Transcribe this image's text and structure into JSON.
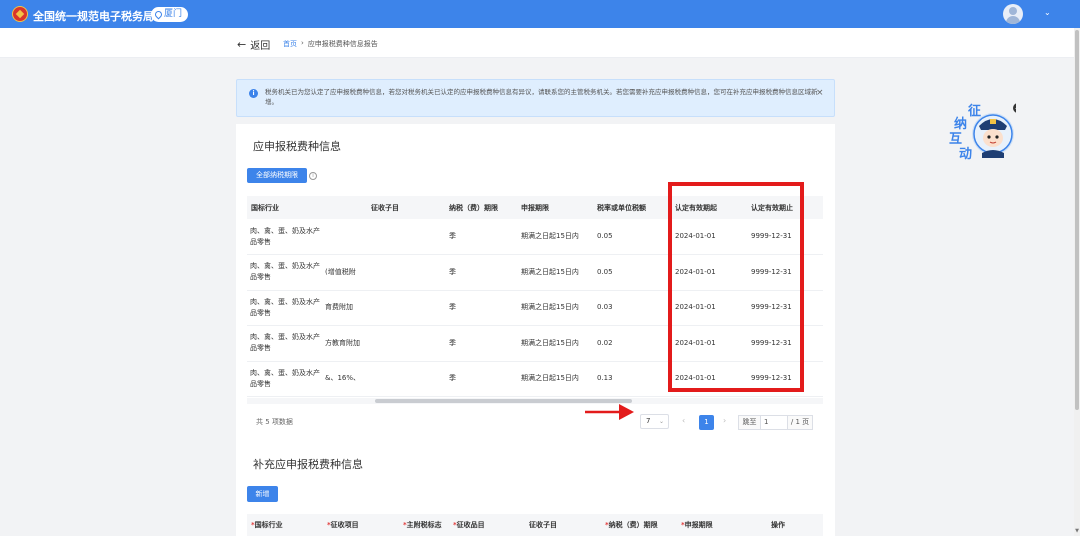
{
  "header": {
    "app_title": "全国统一规范电子税务局",
    "city": "厦门",
    "avatar_icon": "user-avatar-icon",
    "menu_icon": "chevron-down-icon"
  },
  "nav": {
    "back_label": "返回",
    "breadcrumb_home": "首页",
    "breadcrumb_sep": "›",
    "breadcrumb_current": "应申报税费种信息报告"
  },
  "alert": {
    "icon": "i",
    "text": "税务机关已为您认定了应申报税费种信息，若您对税务机关已认定的应申报税费种信息有异议，请联系您的主管税务机关。若您需要补充应申报税费种信息，您可在补充应申报税费种信息区域新增。",
    "close": "×"
  },
  "section1": {
    "title": "应申报税费种信息",
    "button": "全部纳税期限"
  },
  "table1": {
    "headers": [
      "国标行业",
      "征收子目",
      "纳税（费）期限",
      "申报期限",
      "税率或单位税额",
      "认定有效期起",
      "认定有效期止"
    ],
    "rows": [
      {
        "industry": "肉、禽、蛋、奶及水产品零售",
        "sub": "",
        "period": "季",
        "deadline": "期满之日起15日内",
        "rate": "0.05",
        "start": "2024-01-01",
        "end": "9999-12-31"
      },
      {
        "industry": "肉、禽、蛋、奶及水产品零售",
        "sub": "(增值税附",
        "period": "季",
        "deadline": "期满之日起15日内",
        "rate": "0.05",
        "start": "2024-01-01",
        "end": "9999-12-31"
      },
      {
        "industry": "肉、禽、蛋、奶及水产品零售",
        "sub": "育费附加",
        "period": "季",
        "deadline": "期满之日起15日内",
        "rate": "0.03",
        "start": "2024-01-01",
        "end": "9999-12-31"
      },
      {
        "industry": "肉、禽、蛋、奶及水产品零售",
        "sub": "方教育附加",
        "period": "季",
        "deadline": "期满之日起15日内",
        "rate": "0.02",
        "start": "2024-01-01",
        "end": "9999-12-31"
      },
      {
        "industry": "肉、禽、蛋、奶及水产品零售",
        "sub": "&、16%、",
        "period": "季",
        "deadline": "期满之日起15日内",
        "rate": "0.13",
        "start": "2024-01-01",
        "end": "9999-12-31"
      }
    ]
  },
  "pagination": {
    "total": "共 5 项数据",
    "page_size": "7",
    "prev": "‹",
    "current": "1",
    "next": "›",
    "jump_label": "跳至",
    "jump_value": "1",
    "page_total": "/ 1 页"
  },
  "section2": {
    "title": "补充应申报税费种信息",
    "button": "新增"
  },
  "table2": {
    "headers": [
      {
        "req": "*",
        "label": "国标行业"
      },
      {
        "req": "*",
        "label": "征收项目"
      },
      {
        "req": "*",
        "label": "主附税标志"
      },
      {
        "req": "*",
        "label": "征收品目"
      },
      {
        "req": "",
        "label": "征收子目"
      },
      {
        "req": "*",
        "label": "纳税（费）期限"
      },
      {
        "req": "*",
        "label": "申报期限"
      },
      {
        "req": "",
        "label": "操作"
      }
    ]
  },
  "mascot": {
    "chars": [
      "征",
      "纳",
      "互",
      "动"
    ],
    "minimize": "−"
  },
  "colors": {
    "primary": "#3d84ea",
    "highlight": "#e31b1b",
    "alert_bg": "#dfeefe"
  }
}
